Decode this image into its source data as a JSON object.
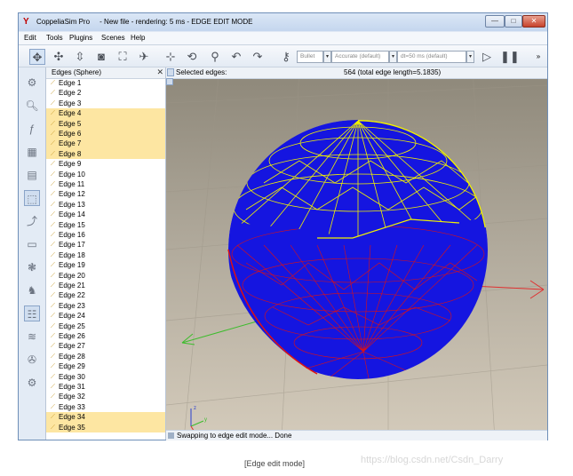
{
  "window": {
    "app_name": "CoppeliaSim Pro",
    "title": "- New file - rendering: 5 ms - EDGE EDIT MODE",
    "min_label": "—",
    "max_label": "□",
    "close_label": "✕"
  },
  "menu": [
    "Edit",
    "Tools",
    "Plugins",
    "Scenes",
    "Help"
  ],
  "toolbar": {
    "engine": "Bullet",
    "accuracy": "Accurate (default)",
    "dt": "dt=50 ms (default)",
    "more": "»"
  },
  "edges_panel": {
    "title": "Edges (Sphere)",
    "close": "✕",
    "items": [
      {
        "label": "Edge 1",
        "selected": false
      },
      {
        "label": "Edge 2",
        "selected": false
      },
      {
        "label": "Edge 3",
        "selected": false
      },
      {
        "label": "Edge 4",
        "selected": true
      },
      {
        "label": "Edge 5",
        "selected": true
      },
      {
        "label": "Edge 6",
        "selected": true
      },
      {
        "label": "Edge 7",
        "selected": true
      },
      {
        "label": "Edge 8",
        "selected": true
      },
      {
        "label": "Edge 9",
        "selected": false
      },
      {
        "label": "Edge 10",
        "selected": false
      },
      {
        "label": "Edge 11",
        "selected": false
      },
      {
        "label": "Edge 12",
        "selected": false
      },
      {
        "label": "Edge 13",
        "selected": false
      },
      {
        "label": "Edge 14",
        "selected": false
      },
      {
        "label": "Edge 15",
        "selected": false
      },
      {
        "label": "Edge 16",
        "selected": false
      },
      {
        "label": "Edge 17",
        "selected": false
      },
      {
        "label": "Edge 18",
        "selected": false
      },
      {
        "label": "Edge 19",
        "selected": false
      },
      {
        "label": "Edge 20",
        "selected": false
      },
      {
        "label": "Edge 21",
        "selected": false
      },
      {
        "label": "Edge 22",
        "selected": false
      },
      {
        "label": "Edge 23",
        "selected": false
      },
      {
        "label": "Edge 24",
        "selected": false
      },
      {
        "label": "Edge 25",
        "selected": false
      },
      {
        "label": "Edge 26",
        "selected": false
      },
      {
        "label": "Edge 27",
        "selected": false
      },
      {
        "label": "Edge 28",
        "selected": false
      },
      {
        "label": "Edge 29",
        "selected": false
      },
      {
        "label": "Edge 30",
        "selected": false
      },
      {
        "label": "Edge 31",
        "selected": false
      },
      {
        "label": "Edge 32",
        "selected": false
      },
      {
        "label": "Edge 33",
        "selected": false
      },
      {
        "label": "Edge 34",
        "selected": true
      },
      {
        "label": "Edge 35",
        "selected": true
      }
    ]
  },
  "viewport": {
    "selected_label": "Selected edges:",
    "selected_info": "564 (total edge length=5.1835)",
    "axis_z": "z",
    "axis_y": "y",
    "axis_x": "x"
  },
  "status": {
    "message": "Swapping to edge edit mode... Done"
  },
  "caption": "[Edge edit mode]",
  "watermark": "https://blog.csdn.net/Csdn_Darry",
  "colors": {
    "sphere": "#1515e0",
    "selected_edge": "#f2f200",
    "mesh_edge": "#e01010"
  }
}
